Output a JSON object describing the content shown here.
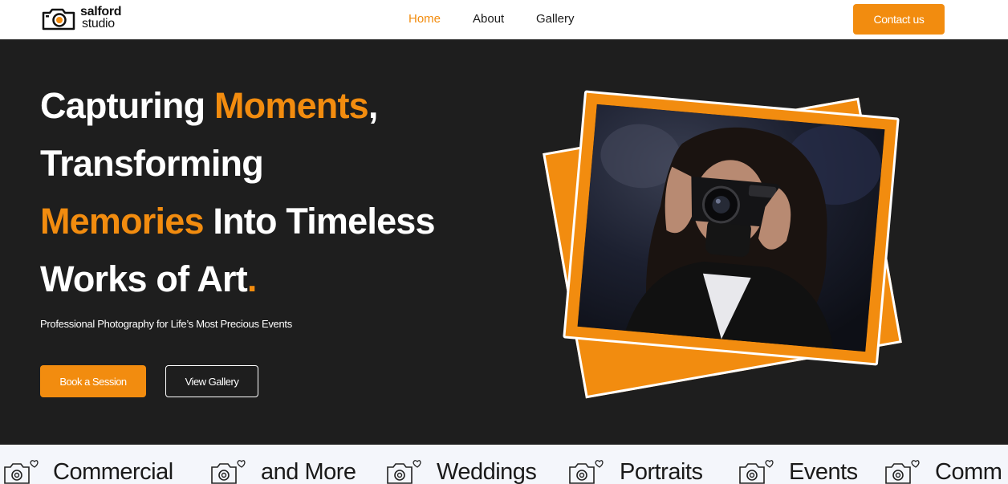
{
  "nav": {
    "brand_line1": "salford",
    "brand_line2": "studio",
    "links": [
      {
        "label": "Home",
        "active": true
      },
      {
        "label": "About",
        "active": false
      },
      {
        "label": "Gallery",
        "active": false
      }
    ],
    "contact_label": "Contact us"
  },
  "hero": {
    "line1_a": "Capturing ",
    "line1_b": "Moments",
    "line1_c": ",",
    "line2": "Transforming",
    "line3_a": "Memories",
    "line3_b": " Into Timeless",
    "line4_a": "Works of Art",
    "line4_b": ".",
    "subtitle": "Professional Photography for Life’s Most Precious Events",
    "primary_button": "Book a Session",
    "secondary_button": "View Gallery"
  },
  "marquee": {
    "items": [
      "Commercial",
      "and More",
      "Weddings",
      "Portraits",
      "Events",
      "Comm"
    ],
    "icon": "camera-heart-icon"
  },
  "colors": {
    "accent": "#f28c0f",
    "dark": "#1e1e1e",
    "light": "#ffffff",
    "strip": "#f4f6fb"
  }
}
